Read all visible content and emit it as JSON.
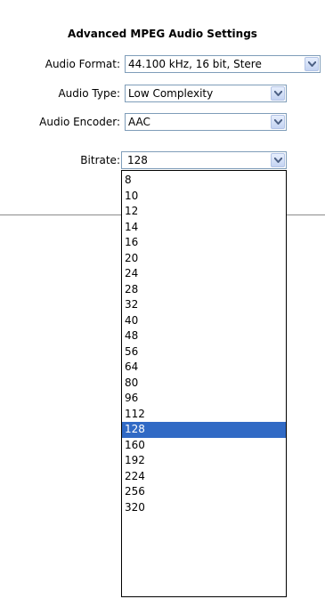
{
  "title": "Advanced MPEG Audio Settings",
  "fields": {
    "audio_format": {
      "label": "Audio Format:",
      "value": "44.100 kHz, 16 bit, Stere"
    },
    "audio_type": {
      "label": "Audio Type:",
      "value": "Low Complexity"
    },
    "audio_encoder": {
      "label": "Audio Encoder:",
      "value": "AAC"
    },
    "bitrate": {
      "label": "Bitrate:",
      "value": "128"
    }
  },
  "bitrate_options": [
    "8",
    "10",
    "12",
    "14",
    "16",
    "20",
    "24",
    "28",
    "32",
    "40",
    "48",
    "56",
    "64",
    "80",
    "96",
    "112",
    "128",
    "160",
    "192",
    "224",
    "256",
    "320"
  ],
  "selected_bitrate": "128",
  "colors": {
    "selection": "#316ac5",
    "border": "#7f9db9"
  },
  "icons": {
    "dropdown_arrow": "chevron-down-icon"
  }
}
